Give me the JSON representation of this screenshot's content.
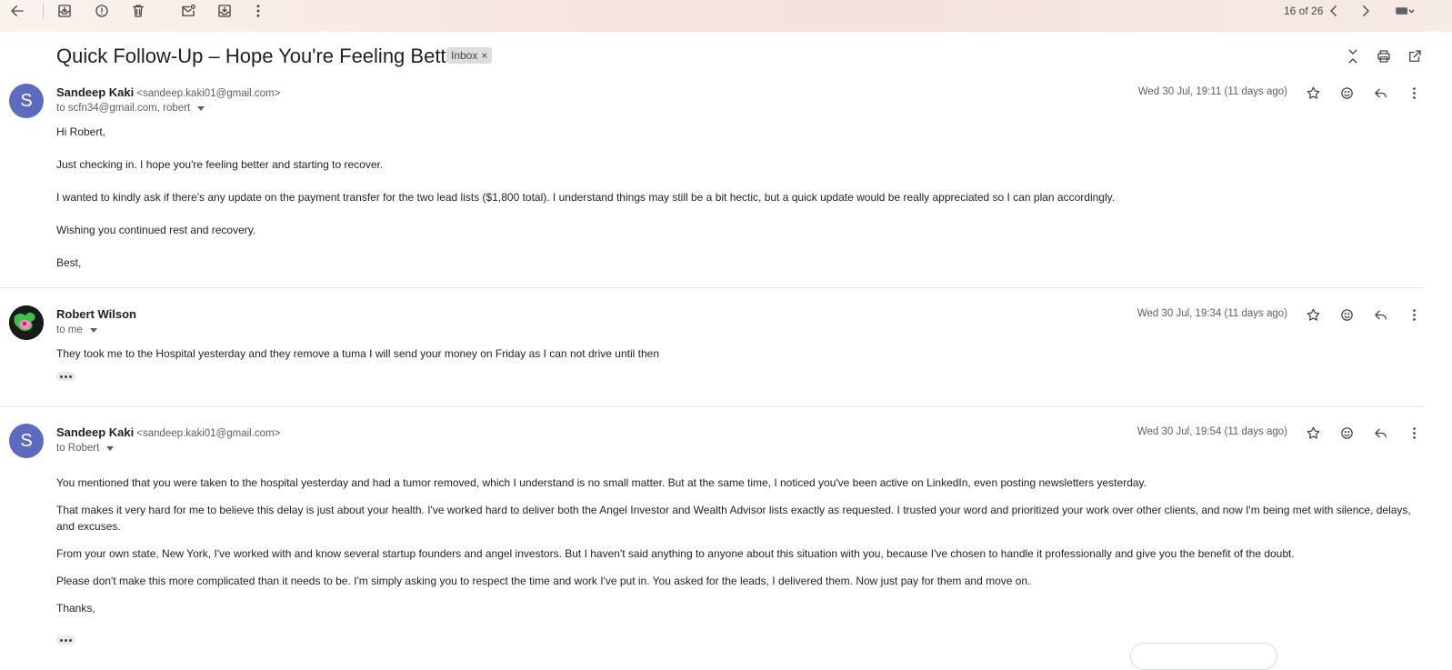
{
  "toolbar": {
    "counter": "16 of 26",
    "icons": [
      "back-arrow-icon",
      "archive-icon",
      "report-spam-icon",
      "delete-icon",
      "mark-unread-icon",
      "move-to-icon",
      "more-vert-icon",
      "newer-icon",
      "older-icon",
      "keyboard-icon"
    ]
  },
  "thread": {
    "subject": "Quick Follow-Up – Hope You're Feeling Better",
    "label": "Inbox",
    "label_close": "×"
  },
  "messages": [
    {
      "avatar_letter": "S",
      "sender_name": "Sandeep Kaki",
      "sender_email": "<sandeep.kaki01@gmail.com>",
      "to": "to scfn34@gmail.com, robert",
      "date": "Wed 30 Jul, 19:11 (11 days ago)",
      "body": [
        "Hi Robert,",
        "Just checking in. I hope you're feeling better and starting to recover.",
        "I wanted to kindly ask if there's any update on the payment transfer for the two lead lists ($1,800 total). I understand things may still be a bit hectic, but a quick update would be really appreciated so I can plan accordingly.",
        "Wishing you continued rest and recovery.",
        "Best,"
      ]
    },
    {
      "avatar_letter": "",
      "sender_name": "Robert Wilson",
      "sender_email": "",
      "to": "to me",
      "date": "Wed 30 Jul, 19:34 (11 days ago)",
      "body": [
        "They took me to the Hospital yesterday and they remove a tuma I will send your money on Friday as I can not drive until then"
      ]
    },
    {
      "avatar_letter": "S",
      "sender_name": "Sandeep Kaki",
      "sender_email": "<sandeep.kaki01@gmail.com>",
      "to": "to Robert",
      "date": "Wed 30 Jul, 19:54 (11 days ago)",
      "body": [
        "You mentioned that you were taken to the hospital yesterday and had a tumor removed, which I understand is no small matter. But at the same time, I noticed you've been active on LinkedIn, even posting newsletters yesterday.",
        "That makes it very hard for me to believe this delay is just about your health. I've worked hard to deliver both the Angel Investor and Wealth Advisor lists exactly as requested. I trusted your word and prioritized your work over other clients, and now I'm being met with silence, delays, and excuses.",
        "From your own state, New York, I've worked with and know several startup founders and angel investors. But I haven't said anything to anyone about this situation with you, because I've chosen to handle it professionally and give you the benefit of the doubt.",
        "Please don't make this more complicated than it needs to be. I'm simply asking you to respect the time and work I've put in. You asked for the leads, I delivered them. Now just pay for them and move on.",
        "Thanks,"
      ]
    }
  ],
  "colors": {
    "avatar_s": "#5c6bc0",
    "topbar": "#f6e6df"
  }
}
